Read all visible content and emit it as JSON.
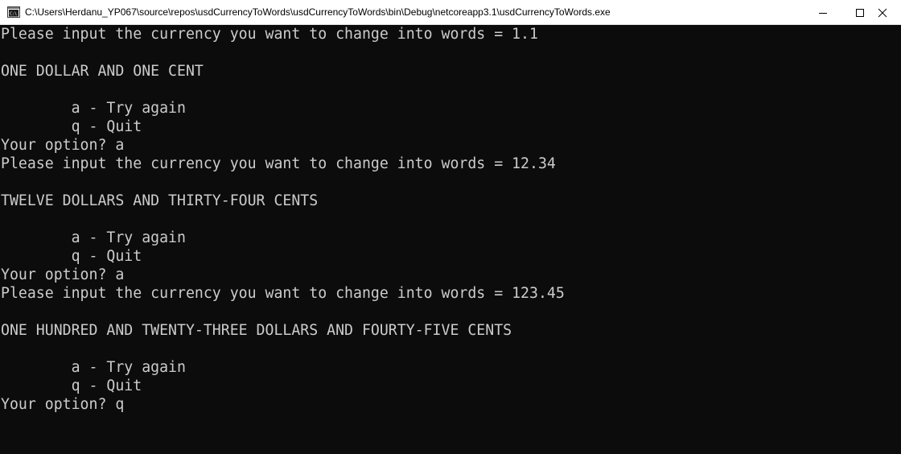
{
  "window": {
    "title": "C:\\Users\\Herdanu_YP067\\source\\repos\\usdCurrencyToWords\\usdCurrencyToWords\\bin\\Debug\\netcoreapp3.1\\usdCurrencyToWords.exe",
    "icon": "console-app-icon",
    "controls": {
      "minimize_icon": "minimize-icon",
      "maximize_icon": "maximize-icon",
      "close_icon": "close-icon"
    }
  },
  "console": {
    "lines": [
      "Please input the currency you want to change into words = 1.1",
      "ONE DOLLAR AND ONE CENT",
      "        a - Try again",
      "        q - Quit",
      "Your option? a",
      "Please input the currency you want to change into words = 12.34",
      "TWELVE DOLLARS AND THIRTY-FOUR CENTS",
      "        a - Try again",
      "        q - Quit",
      "Your option? a",
      "Please input the currency you want to change into words = 123.45",
      "ONE HUNDRED AND TWENTY-THREE DOLLARS AND FOURTY-FIVE CENTS",
      "        a - Try again",
      "        q - Quit",
      "Your option? q"
    ],
    "colors": {
      "background": "#0c0c0c",
      "foreground": "#cccccc"
    }
  }
}
